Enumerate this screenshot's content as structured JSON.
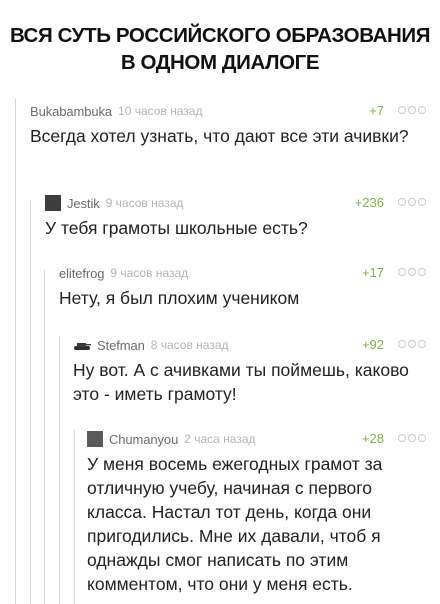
{
  "header": {
    "title_line1": "ВСЯ СУТЬ РОССИЙСКОГО ОБРАЗОВАНИЯ",
    "title_line2": "В ОДНОМ ДИАЛОГЕ"
  },
  "comments": [
    {
      "author": "Bukabambuka",
      "time": "10 часов назад",
      "rating": "+7",
      "text": "Всегда хотел узнать, что дают все эти ачивки?"
    },
    {
      "author": "Jestik",
      "time": "9 часов назад",
      "rating": "+236",
      "text": "У тебя грамоты школьные есть?"
    },
    {
      "author": "elitefrog",
      "time": "9 часов назад",
      "rating": "+17",
      "text": "Нету, я был плохим учеником"
    },
    {
      "author": "Stefman",
      "time": "8 часов назад",
      "rating": "+92",
      "text": "Ну вот. А с ачивками ты поймешь, каково это - иметь грамоту!"
    },
    {
      "author": "Chumanyou",
      "time": "2 часа назад",
      "rating": "+28",
      "text": "У меня восемь ежегодных грамот за отличную учебу, начиная с первого класса. Настал тот день, когда они пригодились. Мне их давали, чтоб я однажды смог написать по этим комментом, что они у меня есть."
    }
  ],
  "colors": {
    "rating": "#7bb241",
    "author": "#6b6b6b",
    "time": "#b3b3b3",
    "branch": "#d7d7d7"
  },
  "icons": {
    "more": "more-dots-icon",
    "tank_avatar": "tank-icon"
  }
}
